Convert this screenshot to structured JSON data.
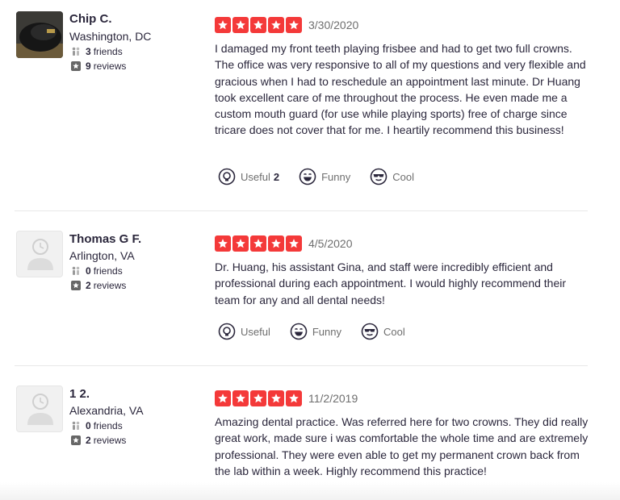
{
  "reviews": [
    {
      "user": {
        "name": "Chip C.",
        "location": "Washington, DC",
        "friends_count": "3",
        "friends_label": "friends",
        "reviews_count": "9",
        "reviews_label": "reviews",
        "avatar": "user-photo"
      },
      "rating": 5,
      "date": "3/30/2020",
      "text": "I damaged my front teeth playing frisbee and had to get two full crowns. The office was very responsive to all of my questions and very flexible and gracious when I had to reschedule an appointment last minute. Dr Huang took excellent care of me throughout the process. He even made me a custom mouth guard (for use while playing sports) free of charge since tricare does not cover that for me. I heartily recommend this business!",
      "actions": {
        "useful_label": "Useful",
        "useful_count": "2",
        "funny_label": "Funny",
        "cool_label": "Cool"
      }
    },
    {
      "user": {
        "name": "Thomas G F.",
        "location": "Arlington, VA",
        "friends_count": "0",
        "friends_label": "friends",
        "reviews_count": "2",
        "reviews_label": "reviews",
        "avatar": "default-avatar"
      },
      "rating": 5,
      "date": "4/5/2020",
      "text": "Dr. Huang, his assistant Gina, and staff were incredibly efficient and professional during each appointment.  I would highly recommend their team for any and all dental needs!",
      "actions": {
        "useful_label": "Useful",
        "funny_label": "Funny",
        "cool_label": "Cool"
      }
    },
    {
      "user": {
        "name": "1 2.",
        "location": "Alexandria, VA",
        "friends_count": "0",
        "friends_label": "friends",
        "reviews_count": "2",
        "reviews_label": "reviews",
        "avatar": "default-avatar"
      },
      "rating": 5,
      "date": "11/2/2019",
      "text": "Amazing dental practice. Was referred here for two crowns. They did really great work, made sure i was comfortable the whole time and are extremely professional. They were even able to get my permanent crown back from the lab within a week. Highly recommend this practice!"
    }
  ],
  "colors": {
    "star_red": "#f43939",
    "text": "#2b273c",
    "muted": "#6e6e6e"
  },
  "icons": {
    "friends": "friends-icon",
    "reviews": "review-count-icon",
    "useful": "useful-icon",
    "funny": "funny-icon",
    "cool": "cool-icon",
    "star": "star-icon"
  }
}
